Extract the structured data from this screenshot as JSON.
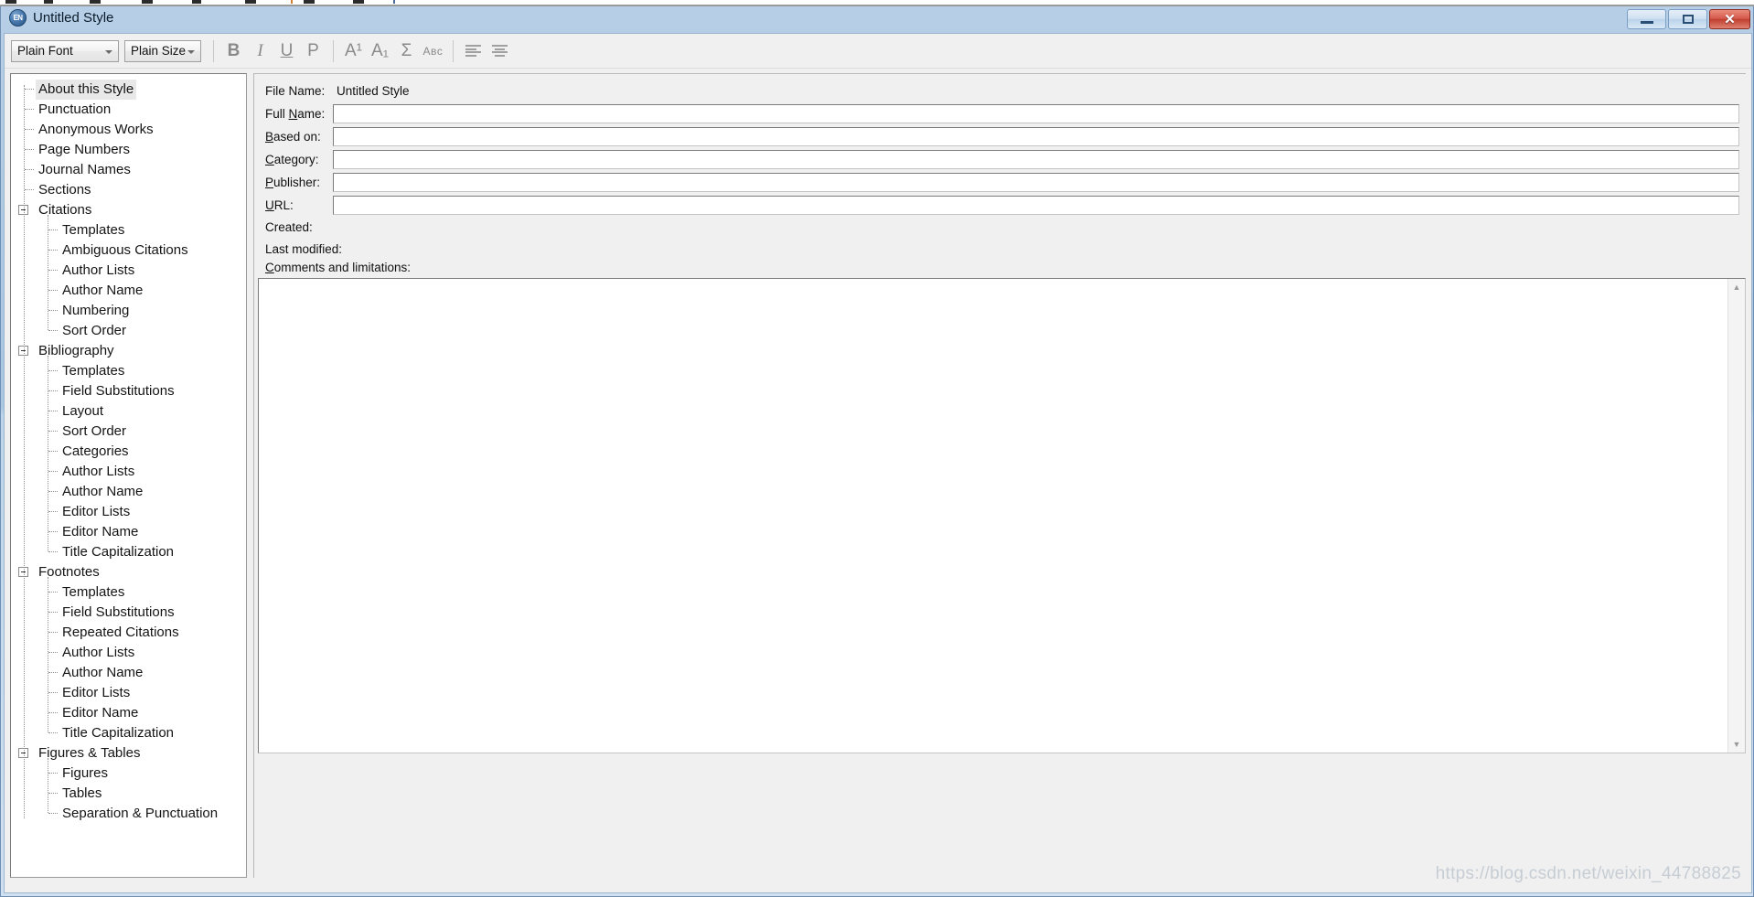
{
  "window": {
    "title": "Untitled Style",
    "app_icon": "endnote-icon",
    "controls": {
      "minimize": "minimize-button",
      "maximize": "maximize-button",
      "close": "close-button",
      "close_glyph": "✕",
      "minimize_glyph": "–",
      "maximize_glyph": "□"
    },
    "accent_titlebar": "#a9c6e2",
    "accent_close": "#bf3d2d"
  },
  "toolbar": {
    "font_combo": {
      "value": "Plain Font",
      "placeholder": "Plain Font"
    },
    "size_combo": {
      "value": "Plain Size",
      "placeholder": "Plain Size"
    },
    "buttons": [
      {
        "name": "bold-button",
        "label": "B"
      },
      {
        "name": "italic-button",
        "label": "I"
      },
      {
        "name": "underline-button",
        "label": "U"
      },
      {
        "name": "plain-button",
        "label": "P"
      },
      {
        "name": "superscript-button",
        "label": "A¹"
      },
      {
        "name": "subscript-button",
        "label": "A₁"
      },
      {
        "name": "link-adjacent-button",
        "label": "Σ"
      },
      {
        "name": "small-caps-button",
        "label": "Aʙᴄ"
      },
      {
        "name": "align-left-button",
        "label": "align left"
      },
      {
        "name": "align-center-button",
        "label": "align center"
      }
    ]
  },
  "tree": {
    "selected": "About this Style",
    "nodes": [
      {
        "label": "About this Style",
        "level": 0,
        "expandable": false,
        "selected": true
      },
      {
        "label": "Punctuation",
        "level": 0,
        "expandable": false,
        "selected": false
      },
      {
        "label": "Anonymous Works",
        "level": 0,
        "expandable": false,
        "selected": false
      },
      {
        "label": "Page Numbers",
        "level": 0,
        "expandable": false,
        "selected": false
      },
      {
        "label": "Journal Names",
        "level": 0,
        "expandable": false,
        "selected": false
      },
      {
        "label": "Sections",
        "level": 0,
        "expandable": false,
        "selected": false
      },
      {
        "label": "Citations",
        "level": 0,
        "expandable": true,
        "selected": false
      },
      {
        "label": "Templates",
        "level": 1,
        "expandable": false,
        "selected": false
      },
      {
        "label": "Ambiguous Citations",
        "level": 1,
        "expandable": false,
        "selected": false
      },
      {
        "label": "Author Lists",
        "level": 1,
        "expandable": false,
        "selected": false
      },
      {
        "label": "Author Name",
        "level": 1,
        "expandable": false,
        "selected": false
      },
      {
        "label": "Numbering",
        "level": 1,
        "expandable": false,
        "selected": false
      },
      {
        "label": "Sort Order",
        "level": 1,
        "expandable": false,
        "selected": false
      },
      {
        "label": "Bibliography",
        "level": 0,
        "expandable": true,
        "selected": false
      },
      {
        "label": "Templates",
        "level": 1,
        "expandable": false,
        "selected": false
      },
      {
        "label": "Field Substitutions",
        "level": 1,
        "expandable": false,
        "selected": false
      },
      {
        "label": "Layout",
        "level": 1,
        "expandable": false,
        "selected": false
      },
      {
        "label": "Sort Order",
        "level": 1,
        "expandable": false,
        "selected": false
      },
      {
        "label": "Categories",
        "level": 1,
        "expandable": false,
        "selected": false
      },
      {
        "label": "Author Lists",
        "level": 1,
        "expandable": false,
        "selected": false
      },
      {
        "label": "Author Name",
        "level": 1,
        "expandable": false,
        "selected": false
      },
      {
        "label": "Editor Lists",
        "level": 1,
        "expandable": false,
        "selected": false
      },
      {
        "label": "Editor Name",
        "level": 1,
        "expandable": false,
        "selected": false
      },
      {
        "label": "Title Capitalization",
        "level": 1,
        "expandable": false,
        "selected": false
      },
      {
        "label": "Footnotes",
        "level": 0,
        "expandable": true,
        "selected": false
      },
      {
        "label": "Templates",
        "level": 1,
        "expandable": false,
        "selected": false
      },
      {
        "label": "Field Substitutions",
        "level": 1,
        "expandable": false,
        "selected": false
      },
      {
        "label": "Repeated Citations",
        "level": 1,
        "expandable": false,
        "selected": false
      },
      {
        "label": "Author Lists",
        "level": 1,
        "expandable": false,
        "selected": false
      },
      {
        "label": "Author Name",
        "level": 1,
        "expandable": false,
        "selected": false
      },
      {
        "label": "Editor Lists",
        "level": 1,
        "expandable": false,
        "selected": false
      },
      {
        "label": "Editor Name",
        "level": 1,
        "expandable": false,
        "selected": false
      },
      {
        "label": "Title Capitalization",
        "level": 1,
        "expandable": false,
        "selected": false
      },
      {
        "label": "Figures & Tables",
        "level": 0,
        "expandable": true,
        "selected": false
      },
      {
        "label": "Figures",
        "level": 1,
        "expandable": false,
        "selected": false
      },
      {
        "label": "Tables",
        "level": 1,
        "expandable": false,
        "selected": false
      },
      {
        "label": "Separation & Punctuation",
        "level": 1,
        "expandable": false,
        "selected": false
      }
    ]
  },
  "form": {
    "file_name_label": "File Name:",
    "file_name_value": "Untitled Style",
    "full_name_label": "Full Name:",
    "full_name_value": "",
    "based_on_label": "Based on:",
    "based_on_value": "",
    "category_label": "Category:",
    "category_value": "",
    "publisher_label": "Publisher:",
    "publisher_value": "",
    "url_label": "URL:",
    "url_value": "",
    "created_label": "Created:",
    "created_value": "",
    "last_modified_label": "Last modified:",
    "last_modified_value": "",
    "comments_label": "Comments and limitations:",
    "comments_value": ""
  },
  "watermark": "https://blog.csdn.net/weixin_44788825"
}
